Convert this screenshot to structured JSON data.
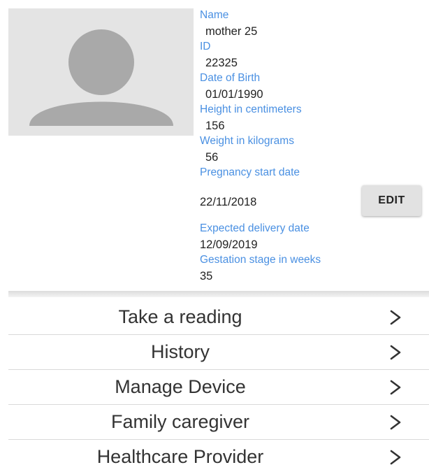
{
  "profile": {
    "fields": [
      {
        "label": "Name",
        "value": "mother 25"
      },
      {
        "label": "ID",
        "value": "22325"
      },
      {
        "label": "Date of Birth",
        "value": "01/01/1990"
      },
      {
        "label": "Height in centimeters",
        "value": "156"
      },
      {
        "label": "Weight in kilograms",
        "value": "56"
      },
      {
        "label": "Pregnancy start date",
        "value": "22/11/2018"
      },
      {
        "label": "Expected delivery date",
        "value": "12/09/2019"
      },
      {
        "label": "Gestation stage in weeks",
        "value": "35"
      }
    ],
    "edit_label": "EDIT"
  },
  "menu": {
    "items": [
      {
        "label": "Take a reading"
      },
      {
        "label": "History"
      },
      {
        "label": "Manage Device"
      },
      {
        "label": "Family caregiver"
      },
      {
        "label": "Healthcare Provider"
      }
    ]
  },
  "icons": {
    "avatar": "person-placeholder-icon",
    "menu_arrow": "chevron-right-icon"
  },
  "colors": {
    "label": "#4a90e2",
    "value": "#222222",
    "avatar_background": "#e4e4e4",
    "avatar_figure": "#a9a9a9",
    "button_background": "#e2e2e2"
  }
}
